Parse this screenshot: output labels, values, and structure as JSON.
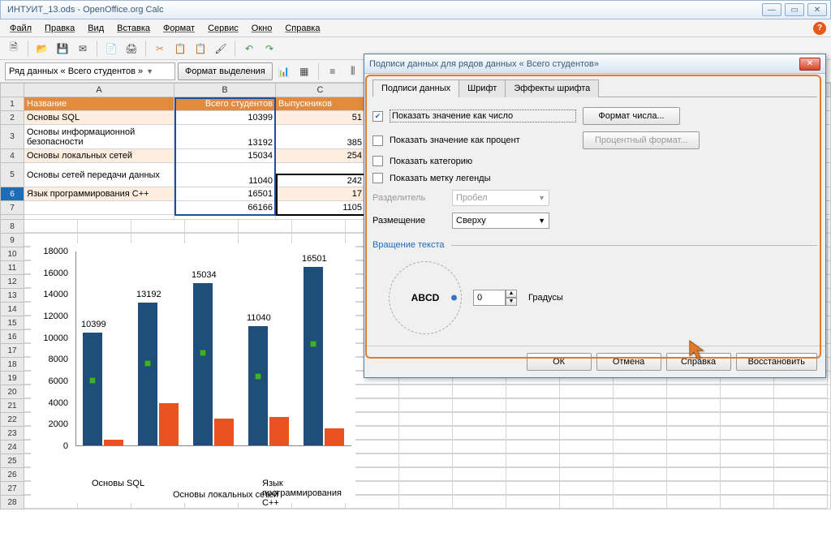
{
  "window": {
    "title": "ИНТУИТ_13.ods - OpenOffice.org Calc"
  },
  "menu": {
    "file": "Файл",
    "edit": "Правка",
    "view": "Вид",
    "insert": "Вставка",
    "format": "Формат",
    "tools": "Сервис",
    "window": "Окно",
    "help": "Справка"
  },
  "toolbar2": {
    "selector": "Ряд данных « Всего студентов »",
    "format_sel": "Формат выделения"
  },
  "columns": {
    "A": "A",
    "B": "B",
    "C": "C"
  },
  "sheet": {
    "headers": {
      "name": "Название",
      "total": "Всего студентов",
      "grad": "Выпускников"
    },
    "rows": [
      {
        "name": "Основы SQL",
        "total": "10399",
        "grad": "51"
      },
      {
        "name": "Основы информационной безопасности",
        "total": "13192",
        "grad": "385"
      },
      {
        "name": "Основы локальных сетей",
        "total": "15034",
        "grad": "254"
      },
      {
        "name": "Основы сетей передачи данных",
        "total": "11040",
        "grad": "242"
      },
      {
        "name": "Язык программирования С++",
        "total": "16501",
        "grad": "17"
      }
    ],
    "sumB": "66166",
    "sumC": "1105"
  },
  "dialog": {
    "title": "Подписи данных для рядов данных « Всего студентов»",
    "tabs": {
      "labels": "Подписи данных",
      "font": "Шрифт",
      "effects": "Эффекты шрифта"
    },
    "opts": {
      "as_number": "Показать значение как число",
      "as_percent": "Показать значение как процент",
      "category": "Показать категорию",
      "legend": "Показать метку легенды"
    },
    "btns": {
      "num_fmt": "Формат числа...",
      "pct_fmt": "Процентный формат..."
    },
    "separator_label": "Разделитель",
    "separator_value": "Пробел",
    "placement_label": "Размещение",
    "placement_value": "Сверху",
    "rotation_label": "Вращение текста",
    "abcd": "ABCD",
    "degrees_value": "0",
    "degrees_label": "Градусы",
    "footer": {
      "ok": "ОК",
      "cancel": "Отмена",
      "help": "Справка",
      "reset": "Восстановить"
    }
  },
  "chart_data": {
    "type": "bar",
    "categories": [
      "Основы SQL",
      "Основы информационной безопасности",
      "Основы локальных сетей",
      "Основы сетей передачи данных",
      "Язык программирования С++"
    ],
    "series": [
      {
        "name": "Всего студентов",
        "values": [
          10399,
          13192,
          15034,
          11040,
          16501
        ]
      },
      {
        "name": "Выпускников",
        "values": [
          500,
          3900,
          2500,
          2600,
          1600
        ]
      }
    ],
    "x_visible_labels": [
      "Основы SQL",
      "Основы локальных сетей",
      "Язык программирования С++"
    ],
    "ylim": [
      0,
      18000
    ],
    "y_ticks": [
      0,
      2000,
      4000,
      6000,
      8000,
      10000,
      12000,
      14000,
      16000,
      18000
    ],
    "title": "",
    "xlabel": "",
    "ylabel": ""
  }
}
